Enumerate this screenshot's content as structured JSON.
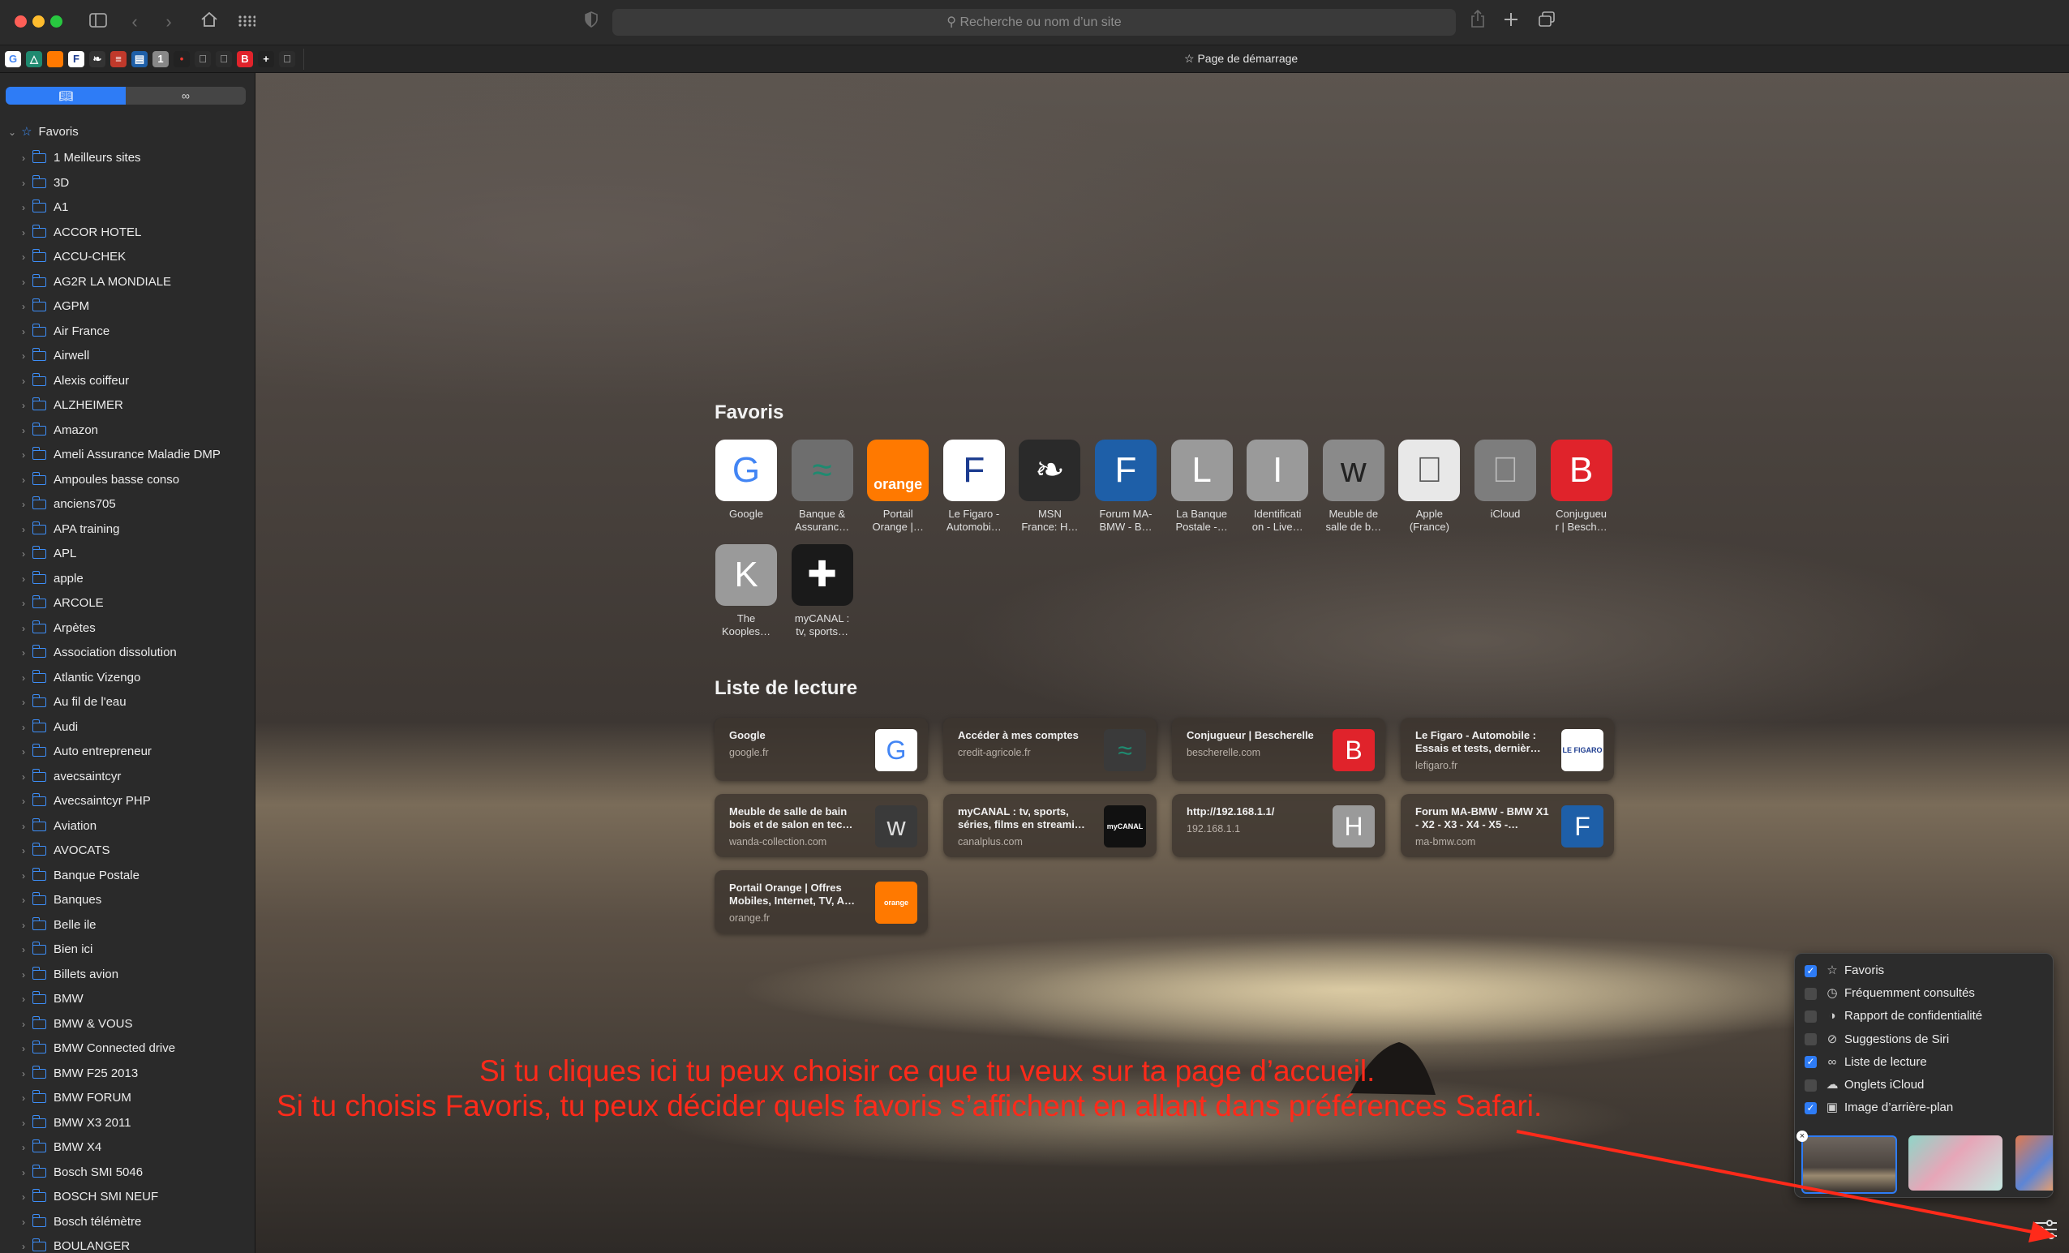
{
  "toolbar": {
    "address_placeholder": "Recherche ou nom d’un site"
  },
  "tabbar": {
    "favorites_bar": [
      {
        "icon": "google-icon",
        "glyph": "G",
        "bg": "#ffffff",
        "color": "#4285f4"
      },
      {
        "icon": "credit-agricole-icon",
        "glyph": "△",
        "bg": "#1f8a70",
        "color": "#ffffff"
      },
      {
        "icon": "orange-icon",
        "glyph": "",
        "bg": "#ff7900",
        "color": "#ffffff"
      },
      {
        "icon": "figaro-icon",
        "glyph": "F",
        "bg": "#ffffff",
        "color": "#1b3b8f"
      },
      {
        "icon": "msn-icon",
        "glyph": "❧",
        "bg": "#333333",
        "color": "#ffffff"
      },
      {
        "icon": "flag-icon",
        "glyph": "≡",
        "bg": "#c0392b",
        "color": "#ffffff"
      },
      {
        "icon": "bmw-forum-icon",
        "glyph": "▤",
        "bg": "#1e5fa8",
        "color": "#ffffff"
      },
      {
        "icon": "number-one-icon",
        "glyph": "1",
        "bg": "#888888",
        "color": "#ffffff"
      },
      {
        "icon": "red-dot-icon",
        "glyph": "•",
        "bg": "#222222",
        "color": "#ff3b30"
      },
      {
        "icon": "apple-icon",
        "glyph": "",
        "bg": "#2c2c2c",
        "color": "#cccccc"
      },
      {
        "icon": "apple-icon",
        "glyph": "",
        "bg": "#2c2c2c",
        "color": "#cccccc"
      },
      {
        "icon": "bescherelle-icon",
        "glyph": "B",
        "bg": "#e0232b",
        "color": "#ffffff"
      },
      {
        "icon": "plus-icon",
        "glyph": "+",
        "bg": "#222222",
        "color": "#ffffff"
      },
      {
        "icon": "apple-icon",
        "glyph": "",
        "bg": "#2c2c2c",
        "color": "#cccccc"
      }
    ],
    "active_tab": "Page de démarrage"
  },
  "sidebar": {
    "root": "Favoris",
    "items": [
      "1 Meilleurs sites",
      "3D",
      "A1",
      "ACCOR HOTEL",
      "ACCU-CHEK",
      "AG2R LA MONDIALE",
      "AGPM",
      "Air France",
      "Airwell",
      "Alexis coiffeur",
      "ALZHEIMER",
      "Amazon",
      "Ameli Assurance Maladie DMP",
      "Ampoules basse conso",
      "anciens705",
      "APA training",
      "APL",
      "apple",
      "ARCOLE",
      "Arpètes",
      "Association dissolution",
      "Atlantic Vizengo",
      "Au fil de l'eau",
      "Audi",
      "Auto entrepreneur",
      "avecsaintcyr",
      "Avecsaintcyr PHP",
      "Aviation",
      "AVOCATS",
      "Banque Postale",
      "Banques",
      "Belle ile",
      "Bien ici",
      "Billets avion",
      "BMW",
      "BMW & VOUS",
      "BMW Connected drive",
      "BMW F25 2013",
      "BMW FORUM",
      "BMW X3 2011",
      "BMW X4",
      "Bosch SMI 5046",
      "BOSCH SMI NEUF",
      "Bosch télémètre",
      "BOULANGER"
    ]
  },
  "favorites": {
    "title": "Favoris",
    "tiles": [
      {
        "l1": "Google",
        "l2": "",
        "glyph": "G",
        "bg": "#ffffff",
        "color": "#4285f4",
        "icon": "google-icon"
      },
      {
        "l1": "Banque &",
        "l2": "Assuranc…",
        "glyph": "≈",
        "bg": "#6e6e6e",
        "color": "#1f8a70",
        "icon": "credit-agricole-icon"
      },
      {
        "l1": "Portail",
        "l2": "Orange |…",
        "glyph": "orange",
        "bg": "#ff7900",
        "color": "#ffffff",
        "icon": "orange-icon"
      },
      {
        "l1": "Le Figaro -",
        "l2": "Automobi…",
        "glyph": "F",
        "bg": "#ffffff",
        "color": "#1b3b8f",
        "icon": "figaro-icon"
      },
      {
        "l1": "MSN",
        "l2": "France: H…",
        "glyph": "❧",
        "bg": "#2a2a2a",
        "color": "#ffffff",
        "icon": "msn-icon"
      },
      {
        "l1": "Forum MA-",
        "l2": "BMW - B…",
        "glyph": "F",
        "bg": "#1e5fa8",
        "color": "#ffffff",
        "icon": "letter-f-icon"
      },
      {
        "l1": "La Banque",
        "l2": "Postale -…",
        "glyph": "L",
        "bg": "#9a9a9a",
        "color": "#ffffff",
        "icon": "letter-l-icon"
      },
      {
        "l1": "Identificati",
        "l2": "on - Live…",
        "glyph": "I",
        "bg": "#9a9a9a",
        "color": "#ffffff",
        "icon": "letter-i-icon"
      },
      {
        "l1": "Meuble de",
        "l2": "salle de b…",
        "glyph": "w",
        "bg": "#8a8a8a",
        "color": "#222222",
        "icon": "wanda-icon"
      },
      {
        "l1": "Apple",
        "l2": "(France)",
        "glyph": "",
        "bg": "#e8e8e8",
        "color": "#555555",
        "icon": "apple-icon"
      },
      {
        "l1": "iCloud",
        "l2": "",
        "glyph": "",
        "bg": "#7d7d7d",
        "color": "#bcbcbc",
        "icon": "icloud-icon"
      },
      {
        "l1": "Conjugueu",
        "l2": "r | Besch…",
        "glyph": "B",
        "bg": "#e0232b",
        "color": "#ffffff",
        "icon": "bescherelle-icon"
      },
      {
        "l1": "The",
        "l2": "Kooples…",
        "glyph": "K",
        "bg": "#9a9a9a",
        "color": "#ffffff",
        "icon": "letter-k-icon"
      },
      {
        "l1": "myCANAL :",
        "l2": "tv, sports…",
        "glyph": "✚",
        "bg": "#1a1a1a",
        "color": "#ffffff",
        "icon": "plus-icon"
      }
    ]
  },
  "reading_list": {
    "title": "Liste de lecture",
    "cards": [
      {
        "title": "Google",
        "url": "google.fr",
        "glyph": "G",
        "bg": "#ffffff",
        "color": "#4285f4",
        "icon": "google-icon"
      },
      {
        "title": "Accéder à mes comptes",
        "url": "credit-agricole.fr",
        "glyph": "≈",
        "bg": "#3a3a3a",
        "color": "#1f8a70",
        "icon": "credit-agricole-icon"
      },
      {
        "title": "Conjugueur | Bescherelle",
        "url": "bescherelle.com",
        "glyph": "B",
        "bg": "#e0232b",
        "color": "#ffffff",
        "icon": "bescherelle-icon"
      },
      {
        "title": "Le Figaro - Automobile : Essais et tests, dernièr…",
        "url": "lefigaro.fr",
        "glyph": "LE FIGARO",
        "bg": "#ffffff",
        "color": "#1b3b8f",
        "icon": "figaro-icon"
      },
      {
        "title": "Meuble de salle de bain bois et de salon en tec…",
        "url": "wanda-collection.com",
        "glyph": "w",
        "bg": "#3a3a3a",
        "color": "#dddddd",
        "icon": "wanda-icon"
      },
      {
        "title": "myCANAL : tv, sports, séries, films en streami…",
        "url": "canalplus.com",
        "glyph": "myCANAL",
        "bg": "#111111",
        "color": "#ffffff",
        "icon": "mycanal-icon"
      },
      {
        "title": "http://192.168.1.1/",
        "url": "192.168.1.1",
        "glyph": "H",
        "bg": "#9a9a9a",
        "color": "#ffffff",
        "icon": "letter-h-icon"
      },
      {
        "title": "Forum MA-BMW - BMW X1 - X2 - X3 - X4 - X5 -…",
        "url": "ma-bmw.com",
        "glyph": "F",
        "bg": "#1e5fa8",
        "color": "#ffffff",
        "icon": "letter-f-icon"
      },
      {
        "title": "Portail Orange | Offres Mobiles, Internet, TV, A…",
        "url": "orange.fr",
        "glyph": "orange",
        "bg": "#ff7900",
        "color": "#ffffff",
        "icon": "orange-icon"
      }
    ]
  },
  "customize": {
    "options": [
      {
        "label": "Favoris",
        "checked": true,
        "icon": "star-icon",
        "glyph": "☆"
      },
      {
        "label": "Fréquemment consultés",
        "checked": false,
        "icon": "clock-icon",
        "glyph": "◷"
      },
      {
        "label": "Rapport de confidentialité",
        "checked": false,
        "icon": "shield-icon",
        "glyph": "◑"
      },
      {
        "label": "Suggestions de Siri",
        "checked": false,
        "icon": "compass-icon",
        "glyph": "⊘"
      },
      {
        "label": "Liste de lecture",
        "checked": true,
        "icon": "glasses-icon",
        "glyph": "∞"
      },
      {
        "label": "Onglets iCloud",
        "checked": false,
        "icon": "cloud-icon",
        "glyph": "☁"
      },
      {
        "label": "Image d’arrière-plan",
        "checked": true,
        "icon": "image-icon",
        "glyph": "▣"
      }
    ]
  },
  "annotation": {
    "line1": "Si tu cliques ici tu peux choisir ce que tu veux sur ta page d’accueil.",
    "line2": "Si tu choisis Favoris, tu peux décider quels favoris s’affichent en allant dans préférences Safari."
  },
  "colors": {
    "accent": "#2e7cf6",
    "annotation": "#ff2a1a"
  }
}
